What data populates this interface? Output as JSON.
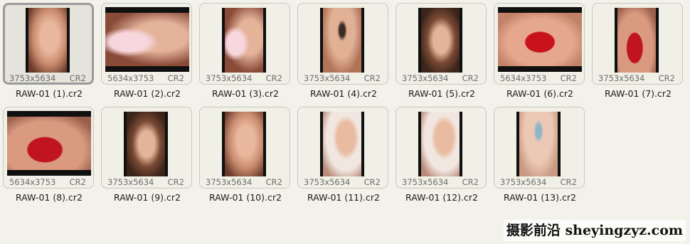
{
  "files": [
    {
      "name": "RAW-01 (1).cr2",
      "dims": "3753x5634",
      "ext": "CR2",
      "orientation": "portrait",
      "photo": "face",
      "selected": true
    },
    {
      "name": "RAW-01 (2).cr2",
      "dims": "5634x3753",
      "ext": "CR2",
      "orientation": "landscape",
      "photo": "lily",
      "selected": false
    },
    {
      "name": "RAW-01 (3).cr2",
      "dims": "3753x5634",
      "ext": "CR2",
      "orientation": "portrait",
      "photo": "lily",
      "selected": false
    },
    {
      "name": "RAW-01 (4).cr2",
      "dims": "3753x5634",
      "ext": "CR2",
      "orientation": "portrait",
      "photo": "eye",
      "selected": false
    },
    {
      "name": "RAW-01 (5).cr2",
      "dims": "3753x5634",
      "ext": "CR2",
      "orientation": "portrait",
      "photo": "hair",
      "selected": false
    },
    {
      "name": "RAW-01 (6).cr2",
      "dims": "5634x3753",
      "ext": "CR2",
      "orientation": "landscape",
      "photo": "lips",
      "selected": false
    },
    {
      "name": "RAW-01 (7).cr2",
      "dims": "3753x5634",
      "ext": "CR2",
      "orientation": "portrait",
      "photo": "lips2",
      "selected": false
    },
    {
      "name": "RAW-01 (8).cr2",
      "dims": "5634x3753",
      "ext": "CR2",
      "orientation": "landscape",
      "photo": "lips2",
      "selected": false
    },
    {
      "name": "RAW-01 (9).cr2",
      "dims": "3753x5634",
      "ext": "CR2",
      "orientation": "portrait",
      "photo": "hair",
      "selected": false
    },
    {
      "name": "RAW-01 (10).cr2",
      "dims": "3753x5634",
      "ext": "CR2",
      "orientation": "portrait",
      "photo": "face",
      "selected": false
    },
    {
      "name": "RAW-01 (11).cr2",
      "dims": "3753x5634",
      "ext": "CR2",
      "orientation": "portrait",
      "photo": "veil",
      "selected": false
    },
    {
      "name": "RAW-01 (12).cr2",
      "dims": "3753x5634",
      "ext": "CR2",
      "orientation": "portrait",
      "photo": "veil",
      "selected": false
    },
    {
      "name": "RAW-01 (13).cr2",
      "dims": "3753x5634",
      "ext": "CR2",
      "orientation": "portrait",
      "photo": "blue",
      "selected": false
    }
  ],
  "watermark": "摄影前沿 sheyingzyz.com"
}
